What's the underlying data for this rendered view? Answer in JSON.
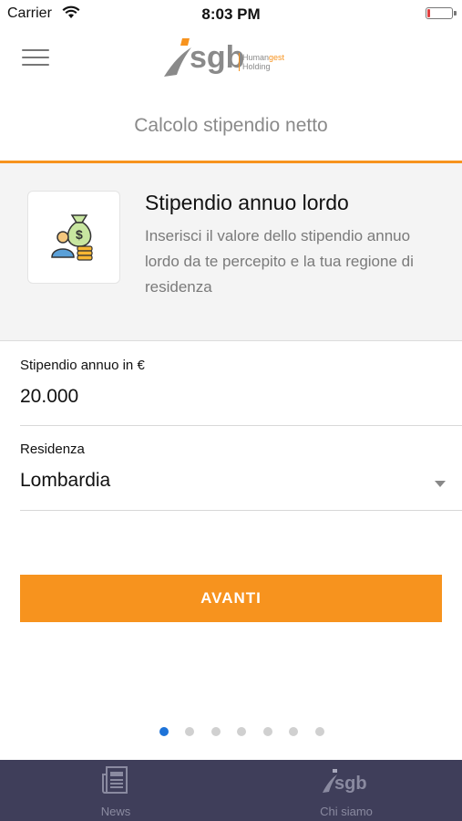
{
  "status_bar": {
    "carrier": "Carrier",
    "time": "8:03 PM"
  },
  "header": {
    "brand": "sgb",
    "brand_line1_a": "Human",
    "brand_line1_b": "gest",
    "brand_line2": "Holding"
  },
  "subtitle": "Calcolo stipendio netto",
  "info": {
    "title": "Stipendio annuo lordo",
    "description": "Inserisci il valore dello stipendio annuo lordo da te percepito e la tua regione di residenza",
    "icon": "money-bag-person-icon"
  },
  "form": {
    "salary_label": "Stipendio annuo in €",
    "salary_value": "20.000",
    "residence_label": "Residenza",
    "residence_value": "Lombardia"
  },
  "button": {
    "label": "AVANTI"
  },
  "pager": {
    "total": 7,
    "active_index": 0
  },
  "tabbar": {
    "items": [
      {
        "label": "News",
        "icon": "newspaper-icon"
      },
      {
        "label": "Chi siamo",
        "icon": "sgb-logo-icon"
      }
    ]
  },
  "colors": {
    "accent": "#f7931e",
    "tabbar": "#3f3e5a",
    "active_dot": "#1e73d8"
  }
}
